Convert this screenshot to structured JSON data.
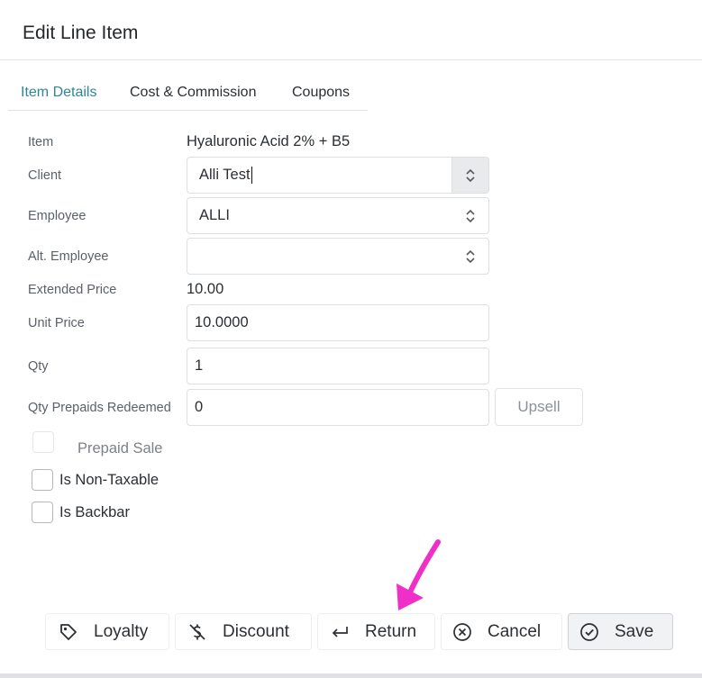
{
  "dialog": {
    "title": "Edit Line Item"
  },
  "tabs": [
    {
      "label": "Item Details",
      "active": true
    },
    {
      "label": "Cost & Commission",
      "active": false
    },
    {
      "label": "Coupons",
      "active": false
    }
  ],
  "form": {
    "item": {
      "label": "Item",
      "value": "Hyaluronic Acid 2% + B5"
    },
    "client": {
      "label": "Client",
      "value": "Alli Test"
    },
    "employee": {
      "label": "Employee",
      "value": "ALLI"
    },
    "alt_employee": {
      "label": "Alt. Employee",
      "value": ""
    },
    "extended_price": {
      "label": "Extended Price",
      "value": "10.00"
    },
    "unit_price": {
      "label": "Unit Price",
      "value": "10.0000"
    },
    "qty": {
      "label": "Qty",
      "value": "1"
    },
    "qty_prepaids": {
      "label": "Qty Prepaids Redeemed",
      "value": "0"
    },
    "upsell_label": "Upsell"
  },
  "checkboxes": {
    "prepaid_sale": {
      "label": "Prepaid Sale",
      "checked": false,
      "disabled": true
    },
    "non_taxable": {
      "label": "Is Non-Taxable",
      "checked": false
    },
    "backbar": {
      "label": "Is Backbar",
      "checked": false
    }
  },
  "footer": {
    "loyalty": "Loyalty",
    "discount": "Discount",
    "return": "Return",
    "cancel": "Cancel",
    "save": "Save"
  },
  "icons": {
    "loyalty": "tag-icon",
    "discount": "no-dollar-icon",
    "return": "return-arrow-icon",
    "cancel": "circle-x-icon",
    "save": "circle-check-icon",
    "select": "chevron-updown-icon"
  },
  "colors": {
    "accent_tab": "#2f8696",
    "annotation_arrow": "#f02ec8",
    "save_bg": "#f1f2f4"
  }
}
